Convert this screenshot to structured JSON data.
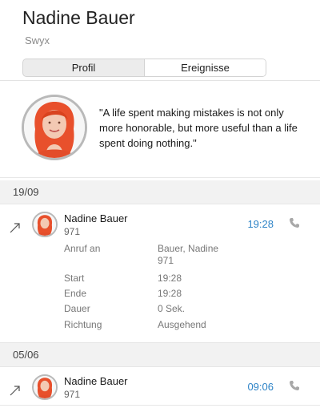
{
  "header": {
    "title": "Nadine Bauer",
    "subtitle": "Swyx",
    "tabs": [
      {
        "label": "Profil",
        "active": false
      },
      {
        "label": "Ereignisse",
        "active": true
      }
    ]
  },
  "profile": {
    "quote": "\"A life spent making mistakes is not only more honorable, but more useful than a life spent doing nothing.\""
  },
  "events": [
    {
      "date": "19/09",
      "name": "Nadine Bauer",
      "number": "971",
      "time": "19:28",
      "direction_icon": "outgoing-arrow-icon",
      "details": [
        {
          "label": "Anruf an",
          "value_lines": [
            "Bauer, Nadine",
            "971"
          ]
        },
        {
          "label": "Start",
          "value_lines": [
            "19:28"
          ]
        },
        {
          "label": "Ende",
          "value_lines": [
            "19:28"
          ]
        },
        {
          "label": "Dauer",
          "value_lines": [
            "0 Sek."
          ]
        },
        {
          "label": "Richtung",
          "value_lines": [
            "Ausgehend"
          ]
        }
      ]
    },
    {
      "date": "05/06",
      "name": "Nadine Bauer",
      "number": "971",
      "time": "09:06",
      "direction_icon": "outgoing-arrow-icon"
    }
  ],
  "colors": {
    "accent": "#2e84c7",
    "hair": "#e8502c",
    "border": "#b9b9b9",
    "section_bg": "#f2f2f2"
  }
}
